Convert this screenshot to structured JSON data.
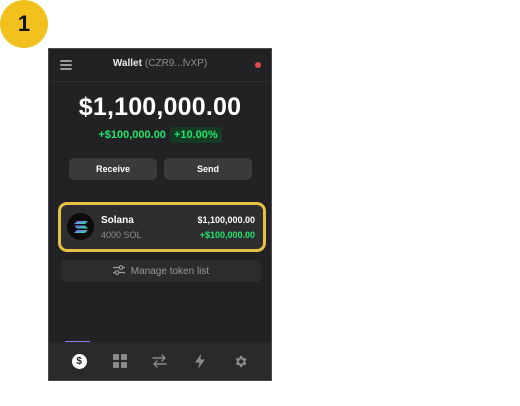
{
  "step_number": "1",
  "header": {
    "title": "Wallet",
    "address": "(CZR9...fvXP)",
    "status_color": "#e5484d"
  },
  "balance": {
    "total": "$1,100,000.00",
    "change_usd": "+$100,000.00",
    "change_pct": "+10.00%"
  },
  "actions": {
    "receive_label": "Receive",
    "send_label": "Send"
  },
  "tokens": [
    {
      "name": "Solana",
      "amount": "4000 SOL",
      "value": "$1,100,000.00",
      "change": "+$100,000.00",
      "icon": "solana-logo-icon"
    }
  ],
  "manage_tokens_label": "Manage token list",
  "bottom_nav": {
    "items": [
      "balance-coin-icon",
      "collectibles-grid-icon",
      "swap-arrows-icon",
      "activity-bolt-icon",
      "settings-gear-icon"
    ],
    "active_index": 0,
    "active_color": "#8b7cf6"
  },
  "colors": {
    "highlight": "#e6c042",
    "positive": "#21e56f",
    "badge": "#f2c11d"
  }
}
